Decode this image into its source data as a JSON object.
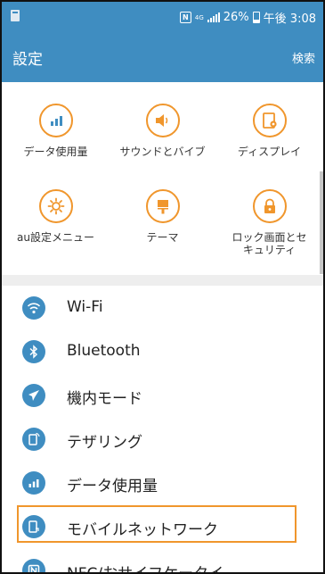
{
  "status_bar": {
    "battery_text": "26%",
    "time": "午後 3:08",
    "network_tag": "4G",
    "nfc_icon": "N"
  },
  "app_bar": {
    "title": "設定",
    "search_label": "検索"
  },
  "quick_settings": [
    {
      "label": "データ使用量",
      "icon": "data-usage-icon"
    },
    {
      "label": "サウンドとバイブ",
      "icon": "sound-icon"
    },
    {
      "label": "ディスプレイ",
      "icon": "display-icon"
    },
    {
      "label": "au設定メニュー",
      "icon": "au-settings-icon"
    },
    {
      "label": "テーマ",
      "icon": "theme-icon"
    },
    {
      "label": "ロック画面とセ\nキュリティ",
      "icon": "lock-icon"
    }
  ],
  "settings_list": [
    {
      "label": "Wi-Fi",
      "icon": "wifi-icon"
    },
    {
      "label": "Bluetooth",
      "icon": "bluetooth-icon"
    },
    {
      "label": "機内モード",
      "icon": "airplane-icon"
    },
    {
      "label": "テザリング",
      "icon": "tethering-icon"
    },
    {
      "label": "データ使用量",
      "icon": "data-usage-icon"
    },
    {
      "label": "モバイルネットワーク",
      "icon": "mobile-network-icon",
      "highlighted": true
    },
    {
      "label": "NFC/おサイフケータイ",
      "icon": "nfc-icon"
    }
  ],
  "colors": {
    "primary": "#3f8dc1",
    "accent": "#f0962c",
    "divider": "#eeeeee"
  }
}
